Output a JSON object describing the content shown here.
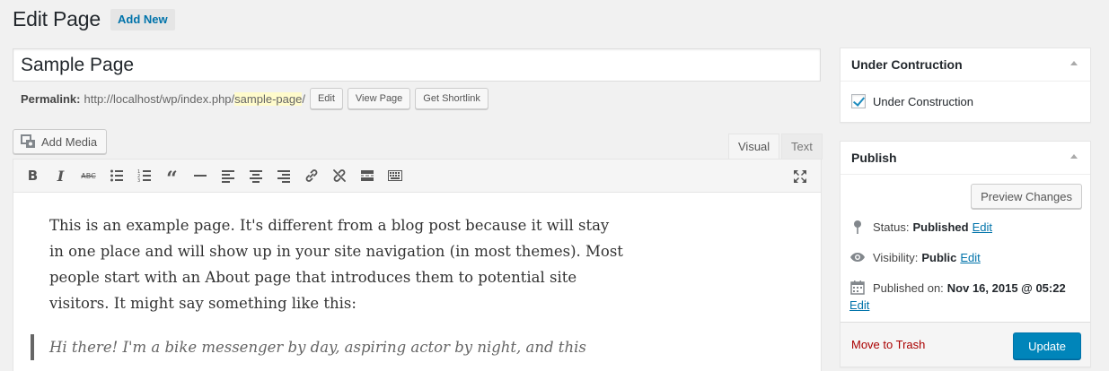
{
  "header": {
    "title": "Edit Page",
    "add_new": "Add New"
  },
  "post": {
    "title": "Sample Page",
    "permalink_label": "Permalink:",
    "permalink_base": "http://localhost/wp/index.php/",
    "permalink_slug": "sample-page",
    "permalink_trail": "/",
    "edit_label": "Edit",
    "view_label": "View Page",
    "shortlink_label": "Get Shortlink"
  },
  "editor": {
    "add_media": "Add Media",
    "tab_visual": "Visual",
    "tab_text": "Text",
    "toolbar_icons": [
      "bold-icon",
      "italic-icon",
      "strikethrough-icon",
      "bulleted-list-icon",
      "numbered-list-icon",
      "blockquote-icon",
      "horizontal-line-icon",
      "align-left-icon",
      "align-center-icon",
      "align-right-icon",
      "insert-link-icon",
      "remove-link-icon",
      "read-more-icon",
      "toolbar-toggle-icon",
      "fullscreen-icon"
    ],
    "paragraph": "This is an example page. It's different from a blog post because it will stay in one place and will show up in your site navigation (in most themes). Most people start with an About page that introduces them to potential site visitors. It might say something like this:",
    "quote": "Hi there! I'm a bike messenger by day, aspiring actor by night, and this"
  },
  "under_construction_box": {
    "title": "Under Contruction",
    "checkbox_label": "Under Construction",
    "checked": true
  },
  "publish_box": {
    "title": "Publish",
    "preview": "Preview Changes",
    "status_label": "Status:",
    "status_value": "Published",
    "visibility_label": "Visibility:",
    "visibility_value": "Public",
    "published_label": "Published on:",
    "published_value": "Nov 16, 2015 @ 05:22",
    "edit": "Edit",
    "trash": "Move to Trash",
    "update": "Update"
  },
  "colors": {
    "accent": "#0085ba",
    "link": "#0073aa",
    "trash": "#a00",
    "slug_highlight": "#fffbcc"
  }
}
